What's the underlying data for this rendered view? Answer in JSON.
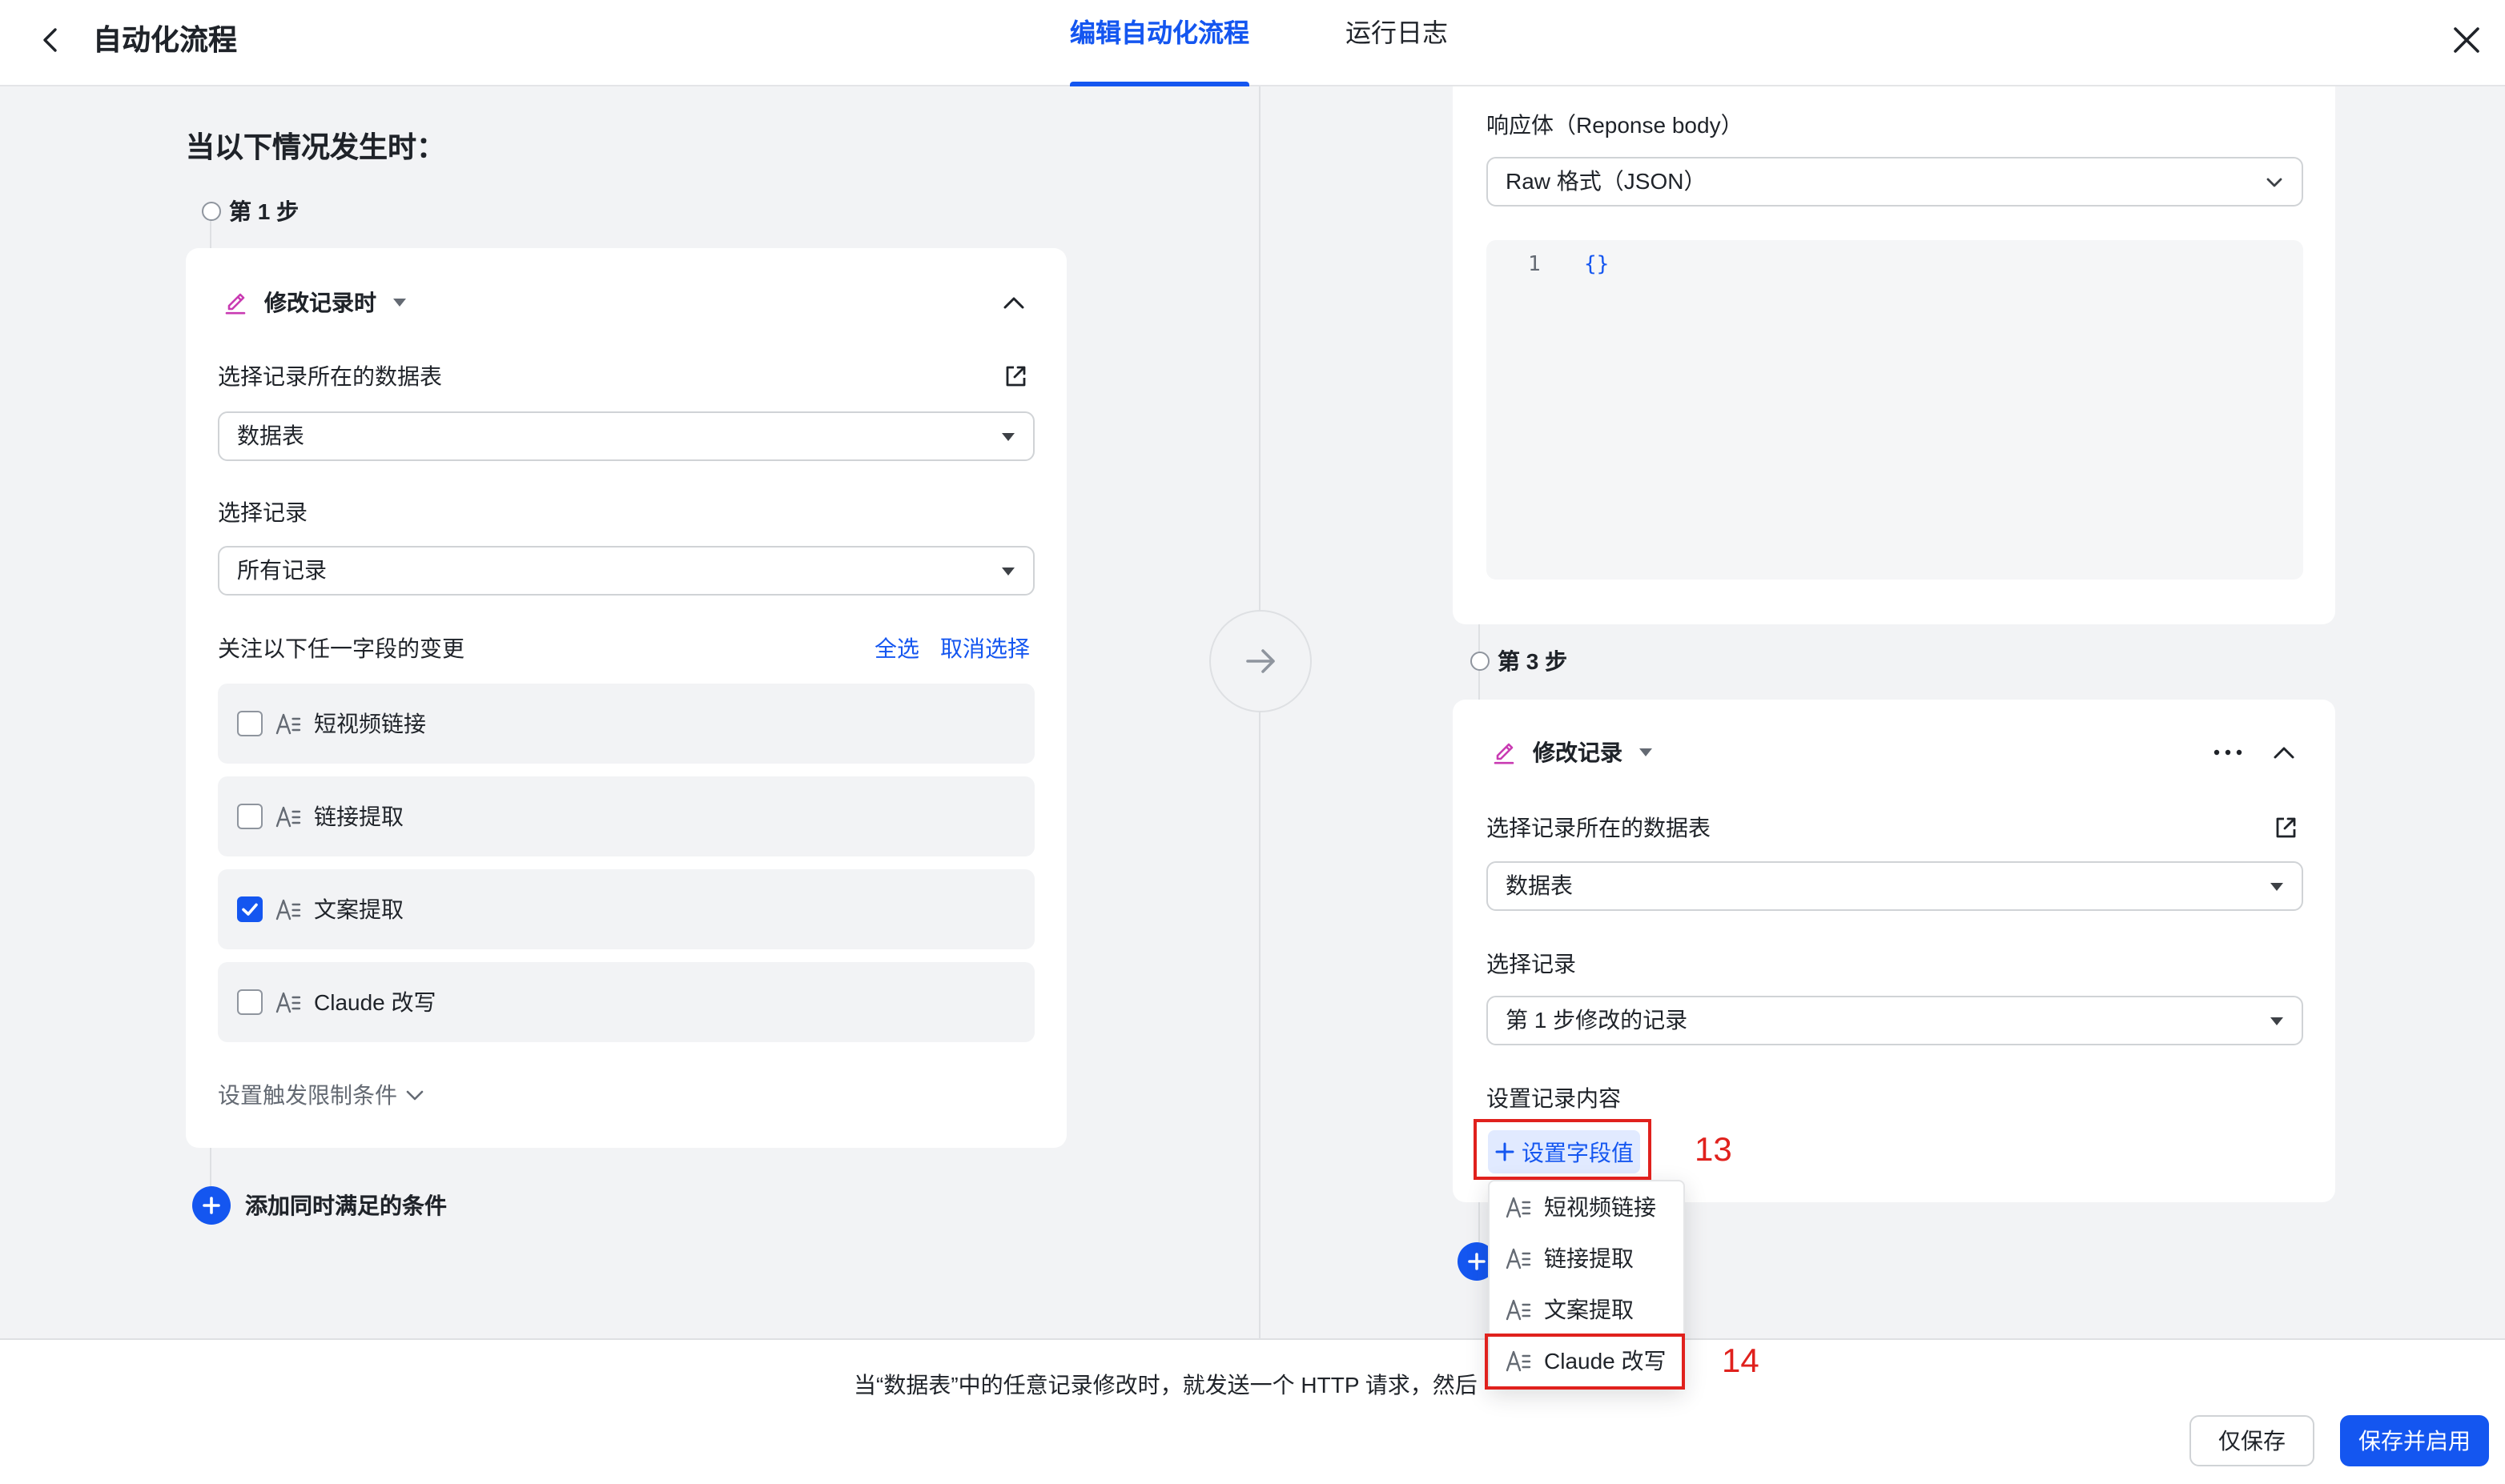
{
  "colors": {
    "accent": "#1456f0",
    "annotation": "#e0211d",
    "edit_icon": "#c93bb2",
    "page_bg": "#f2f3f5"
  },
  "icons": {
    "back": "chevron-left-icon",
    "close": "close-icon",
    "step_type": "pencil-icon",
    "collapse": "chevron-up-icon",
    "open_table": "external-link-icon",
    "field_type": "text-field-icon",
    "flow": "arrow-right-icon",
    "add": "plus-icon",
    "more": "ellipsis-icon"
  },
  "header": {
    "title": "自动化流程",
    "tabs": [
      {
        "label": "编辑自动化流程",
        "active": true
      },
      {
        "label": "运行日志",
        "active": false
      }
    ]
  },
  "trigger": {
    "heading": "当以下情况发生时：",
    "step_label": "第 1 步",
    "type_label": "修改记录时",
    "table_label": "选择记录所在的数据表",
    "table_value": "数据表",
    "record_label": "选择记录",
    "record_value": "所有记录",
    "watch_label": "关注以下任一字段的变更",
    "select_all": "全选",
    "deselect_all": "取消选择",
    "fields": [
      {
        "label": "短视频链接",
        "checked": false
      },
      {
        "label": "链接提取",
        "checked": false
      },
      {
        "label": "文案提取",
        "checked": true
      },
      {
        "label": "Claude 改写",
        "checked": false
      }
    ],
    "limit_conditions": "设置触发限制条件",
    "add_condition": "添加同时满足的条件"
  },
  "http_step": {
    "response_label": "响应体（Reponse body）",
    "format_value": "Raw 格式（JSON）",
    "code_lines": [
      {
        "num": "1",
        "text": "{}"
      }
    ]
  },
  "update_step": {
    "step_label": "第 3 步",
    "type_label": "修改记录",
    "table_label": "选择记录所在的数据表",
    "table_value": "数据表",
    "record_label": "选择记录",
    "record_value": "第 1 步修改的记录",
    "content_label": "设置记录内容",
    "set_field_button": "设置字段值",
    "field_menu": [
      "短视频链接",
      "链接提取",
      "文案提取",
      "Claude 改写"
    ]
  },
  "annotations": {
    "set_field_button": "13",
    "claude_menu_item": "14"
  },
  "footer": {
    "summary": "当“数据表”中的任意记录修改时，就发送一个 HTTP 请求，然后",
    "save_only": "仅保存",
    "save_and_enable": "保存并启用"
  }
}
